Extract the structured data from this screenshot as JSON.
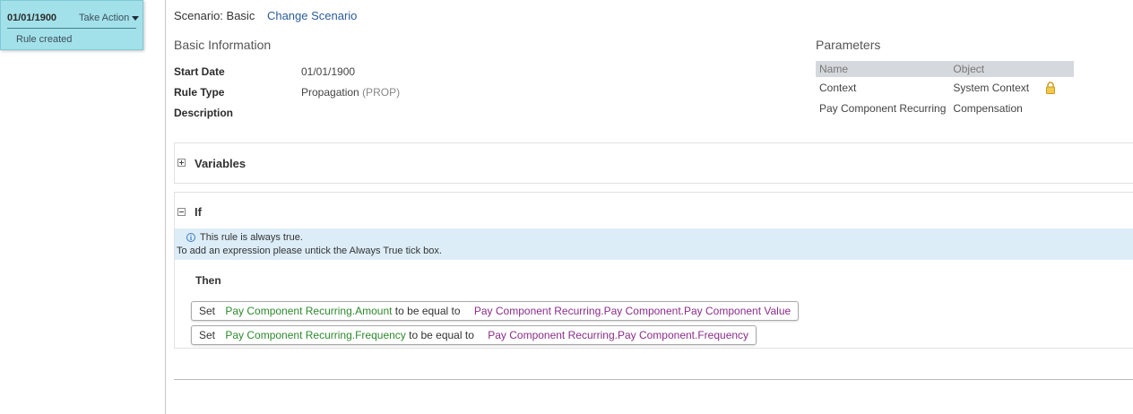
{
  "history": {
    "date": "01/01/1900",
    "take_action": "Take Action",
    "note": "Rule created"
  },
  "scenario": {
    "label": "Scenario: Basic",
    "change_link": "Change Scenario"
  },
  "basic_info": {
    "title": "Basic Information",
    "start_date_label": "Start Date",
    "start_date_value": "01/01/1900",
    "rule_type_label": "Rule Type",
    "rule_type_value": "Propagation",
    "rule_type_code": "(PROP)",
    "description_label": "Description"
  },
  "parameters": {
    "title": "Parameters",
    "columns": [
      "Name",
      "Object"
    ],
    "rows": [
      {
        "name": "Context",
        "object": "System Context",
        "locked": true
      },
      {
        "name": "Pay Component Recurring",
        "object": "Compensation",
        "locked": false
      }
    ]
  },
  "variables": {
    "label": "Variables"
  },
  "if_block": {
    "label": "If",
    "info_line1": "This rule is always true.",
    "info_line2": "To add an expression please untick the Always True tick box.",
    "then_label": "Then",
    "rules": [
      {
        "set": "Set",
        "field": "Pay Component Recurring.Amount",
        "op": "to be equal to",
        "target": "Pay Component Recurring.Pay Component.Pay Component Value"
      },
      {
        "set": "Set",
        "field": "Pay Component Recurring.Frequency",
        "op": "to be equal to",
        "target": "Pay Component Recurring.Pay Component.Frequency"
      }
    ]
  },
  "colors": {
    "history_card": "#a2e1e9",
    "link": "#2a5c9a",
    "field_green": "#2d8a2d",
    "target_purple": "#8a2d8a",
    "info_banner": "#dcedf8"
  }
}
